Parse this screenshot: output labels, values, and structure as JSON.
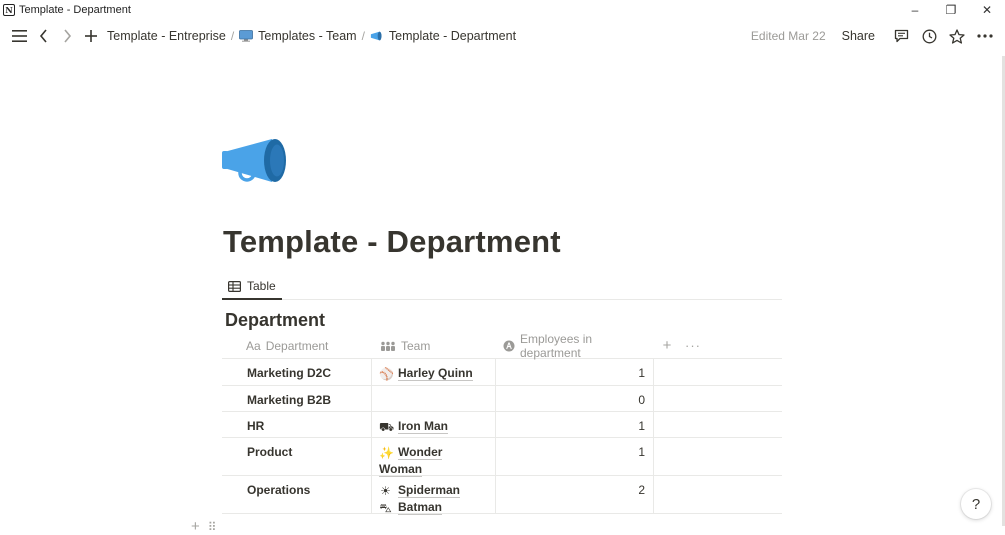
{
  "window": {
    "app_icon_letter": "N",
    "title": "Template - Department",
    "controls": {
      "minimize": "–",
      "restore": "❐",
      "close": "✕"
    }
  },
  "nav": {
    "breadcrumbs": [
      {
        "label": "Template - Entreprise",
        "icon": null
      },
      {
        "label": "Templates - Team",
        "icon": "monitor-icon"
      },
      {
        "label": "Template - Department",
        "icon": "megaphone-icon"
      }
    ],
    "separator": "/",
    "edited": "Edited Mar 22",
    "share": "Share"
  },
  "page": {
    "icon": "megaphone-icon",
    "title": "Template - Department"
  },
  "view": {
    "tab_label": "Table"
  },
  "database": {
    "title": "Department",
    "columns": [
      {
        "label": "Department",
        "icon": "Aa"
      },
      {
        "label": "Team",
        "icon": "people-icon"
      },
      {
        "label": "Employees in department",
        "icon": "formula-icon"
      }
    ],
    "add_column": "+",
    "more": "···",
    "rows": [
      {
        "department": "Marketing D2C",
        "team": [
          {
            "icon": "⚾",
            "name": "Harley Quinn"
          }
        ],
        "employees": "1"
      },
      {
        "department": "Marketing B2B",
        "team": [],
        "employees": "0"
      },
      {
        "department": "HR",
        "team": [
          {
            "icon": "⛟",
            "name": "Iron Man"
          }
        ],
        "employees": "1"
      },
      {
        "department": "Product",
        "team": [
          {
            "icon": "✨",
            "name": "Wonder Woman"
          }
        ],
        "employees": "1"
      },
      {
        "department": "Operations",
        "team": [
          {
            "icon": "☀",
            "name": "Spiderman"
          },
          {
            "icon": "⛍",
            "name": "Batman"
          }
        ],
        "employees": "2"
      }
    ]
  },
  "footer": {
    "add": "+",
    "drag": "⠿",
    "help": "?"
  },
  "colors": {
    "text": "#37352f",
    "muted": "#9b9a97",
    "megaphone": "#4aa3e8",
    "border": "#e9e9e7"
  }
}
